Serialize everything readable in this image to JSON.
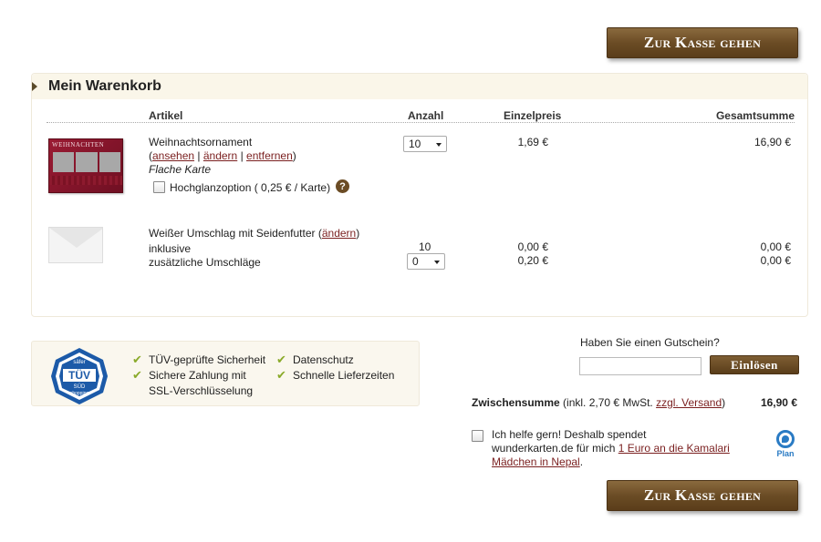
{
  "checkout_button_label": "Zur Kasse gehen",
  "cart": {
    "title": "Mein Warenkorb",
    "columns": {
      "article": "Artikel",
      "quantity": "Anzahl",
      "unit_price": "Einzelpreis",
      "total": "Gesamtsumme"
    },
    "item1": {
      "name": "Weihnachtsornament",
      "open_paren": "(",
      "link_view": "ansehen",
      "sep1": "|",
      "link_change": "ändern",
      "sep2": "|",
      "link_remove": "entfernen",
      "close_paren": ")",
      "variant": "Flache Karte",
      "option_label": "Hochglanzoption ( 0,25 € / Karte)",
      "quantity": "10",
      "unit_price": "1,69 €",
      "total": "16,90 €",
      "card_text": "WEIHNACHTEN"
    },
    "item2": {
      "name": "Weißer Umschlag mit Seidenfutter (",
      "link_change": "ändern",
      "close_paren": ")",
      "line_included": "inklusive",
      "line_additional": "zusätzliche Umschläge",
      "qty_included": "10",
      "qty_additional": "0",
      "unit_price_included": "0,00 €",
      "unit_price_additional": "0,20 €",
      "total_included": "0,00 €",
      "total_additional": "0,00 €"
    }
  },
  "trust": {
    "tuv_top": "säfer",
    "tuv_main": "TÜV",
    "tuv_sub": "SÜD",
    "tuv_bottom": "shopping",
    "item1": "TÜV-geprüfte Sicherheit",
    "item2": "Sichere Zahlung mit",
    "item2b": "SSL-Verschlüsselung",
    "item3": "Datenschutz",
    "item4": "Schnelle Lieferzeiten",
    "check": "✔"
  },
  "voucher": {
    "question": "Haben Sie einen Gutschein?",
    "value": "",
    "button": "Einlösen"
  },
  "subtotal": {
    "label": "Zwischensumme",
    "note": "(inkl. 2,70 € MwSt.",
    "link": "zzgl. Versand",
    "close": ")",
    "value": "16,90 €"
  },
  "donation": {
    "line1": "Ich helfe gern! Deshalb spendet",
    "line2": "wunderkarten.de für mich",
    "link1": "1 Euro an die Kamalari",
    "link2": "Mädchen in Nepal",
    "end": ".",
    "logo_text": "Plan"
  }
}
